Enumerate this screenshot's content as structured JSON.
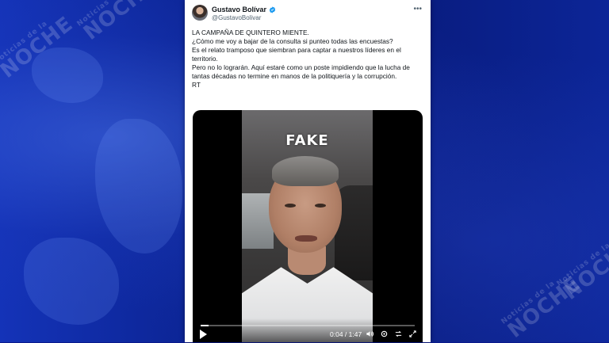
{
  "tweet": {
    "display_name": "Gustavo Bolívar",
    "handle": "@GustavoBolivar",
    "verified": true,
    "more_icon": "more-dots-icon",
    "lines": [
      "LA CAMPAÑA DE QUINTERO MIENTE.",
      "¿Cómo me voy a bajar de la consulta si punteo todas las encuestas?",
      "Es el relato tramposo que siembran para captar a nuestros líderes en el territorio.",
      "Pero no lo lograrán. Aquí estaré como un poste impidiendo que la lucha de tantas décadas no termine en manos de la politiquería y la corrupción.",
      "RT"
    ]
  },
  "video": {
    "overlay_text": "FAKE",
    "current_time": "0:04",
    "separator": " / ",
    "duration": "1:47",
    "progress_fraction": 0.037,
    "icons": [
      "play-icon",
      "volume-icon",
      "settings-icon",
      "loop-icon",
      "fullscreen-icon"
    ]
  },
  "background": {
    "watermark_small": "Noticias de la",
    "watermark_big": "NOCHE",
    "colors": {
      "primary": "#0a1a8c",
      "accent": "#1433b8",
      "verified": "#1d9bf0"
    }
  }
}
